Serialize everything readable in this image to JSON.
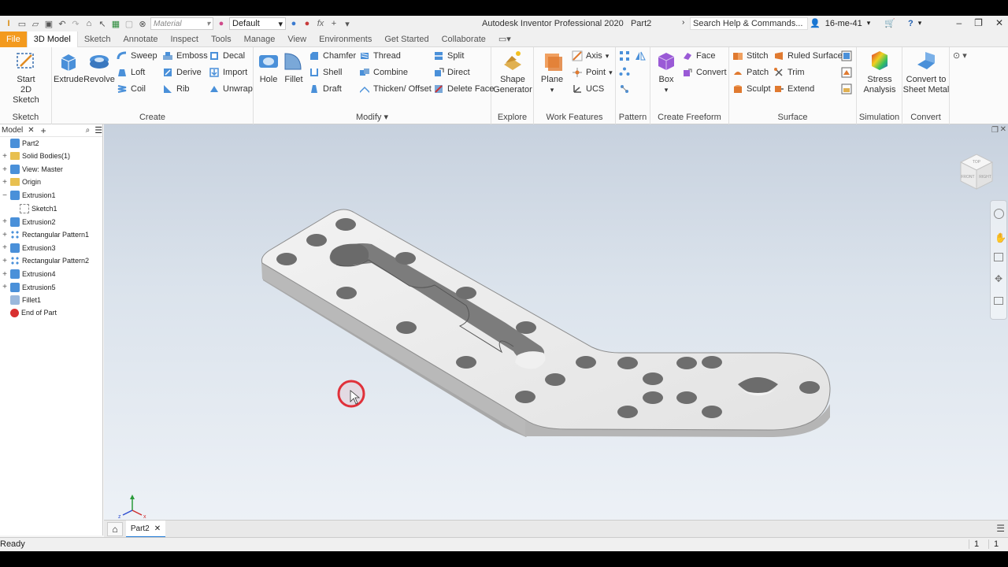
{
  "titlebar": {
    "material_placeholder": "Material",
    "appearance_value": "Default",
    "title": "Autodesk Inventor Professional 2020",
    "doc_name": "Part2",
    "search_placeholder": "Search Help & Commands...",
    "user_name": "16-me-41"
  },
  "tabs": [
    "File",
    "3D Model",
    "Sketch",
    "Annotate",
    "Inspect",
    "Tools",
    "Manage",
    "View",
    "Environments",
    "Get Started",
    "Collaborate"
  ],
  "ribbon": {
    "sketch": {
      "start_line1": "Start",
      "start_line2": "2D Sketch",
      "label": "Sketch"
    },
    "create": {
      "extrude": "Extrude",
      "revolve": "Revolve",
      "sweep": "Sweep",
      "loft": "Loft",
      "coil": "Coil",
      "emboss": "Emboss",
      "derive": "Derive",
      "rib": "Rib",
      "decal": "Decal",
      "import": "Import",
      "unwrap": "Unwrap",
      "label": "Create"
    },
    "modify": {
      "hole": "Hole",
      "fillet": "Fillet",
      "chamfer": "Chamfer",
      "shell": "Shell",
      "draft": "Draft",
      "thread": "Thread",
      "combine": "Combine",
      "thicken": "Thicken/ Offset",
      "split": "Split",
      "direct": "Direct",
      "delete_face": "Delete Face",
      "label": "Modify"
    },
    "explore": {
      "line1": "Shape",
      "line2": "Generator",
      "label": "Explore"
    },
    "work_features": {
      "plane": "Plane",
      "axis": "Axis",
      "point": "Point",
      "ucs": "UCS",
      "label": "Work Features"
    },
    "pattern": {
      "label": "Pattern"
    },
    "freeform": {
      "box": "Box",
      "face": "Face",
      "convert": "Convert",
      "label": "Create Freeform"
    },
    "surface": {
      "stitch": "Stitch",
      "patch": "Patch",
      "sculpt": "Sculpt",
      "ruled": "Ruled Surface",
      "trim": "Trim",
      "extend": "Extend",
      "label": "Surface"
    },
    "simulation": {
      "line1": "Stress",
      "line2": "Analysis",
      "label": "Simulation"
    },
    "convert": {
      "line1": "Convert to",
      "line2": "Sheet Metal",
      "label": "Convert"
    }
  },
  "browser": {
    "tab_label": "Model",
    "items": [
      {
        "label": "Part2",
        "expander": "",
        "icon": "part-icon"
      },
      {
        "label": "Solid Bodies(1)",
        "expander": "+",
        "icon": "folder-icon"
      },
      {
        "label": "View: Master",
        "expander": "+",
        "icon": "view-icon"
      },
      {
        "label": "Origin",
        "expander": "+",
        "icon": "folder-icon"
      },
      {
        "label": "Extrusion1",
        "expander": "−",
        "icon": "extrusion-icon"
      },
      {
        "label": "Sketch1",
        "expander": "",
        "icon": "sketch-icon"
      },
      {
        "label": "Extrusion2",
        "expander": "+",
        "icon": "extrusion-icon"
      },
      {
        "label": "Rectangular Pattern1",
        "expander": "+",
        "icon": "pattern-icon"
      },
      {
        "label": "Extrusion3",
        "expander": "+",
        "icon": "extrusion-icon"
      },
      {
        "label": "Rectangular Pattern2",
        "expander": "+",
        "icon": "pattern-icon"
      },
      {
        "label": "Extrusion4",
        "expander": "+",
        "icon": "extrusion-icon"
      },
      {
        "label": "Extrusion5",
        "expander": "+",
        "icon": "extrusion-icon"
      },
      {
        "label": "Fillet1",
        "expander": "",
        "icon": "fillet-icon"
      },
      {
        "label": "End of Part",
        "expander": "",
        "icon": "end-of-part-icon"
      }
    ]
  },
  "viewcube": {
    "top": "TOP",
    "front": "FRONT",
    "right": "RIGHT"
  },
  "doc_tab": "Part2",
  "status": {
    "text": "Ready",
    "count1": "1",
    "count2": "1"
  },
  "colors": {
    "file_tab": "#f39a1e",
    "viewport_top": "#c7d1de",
    "viewport_bottom": "#eef2f7",
    "cursor_ring": "#e0313a"
  }
}
